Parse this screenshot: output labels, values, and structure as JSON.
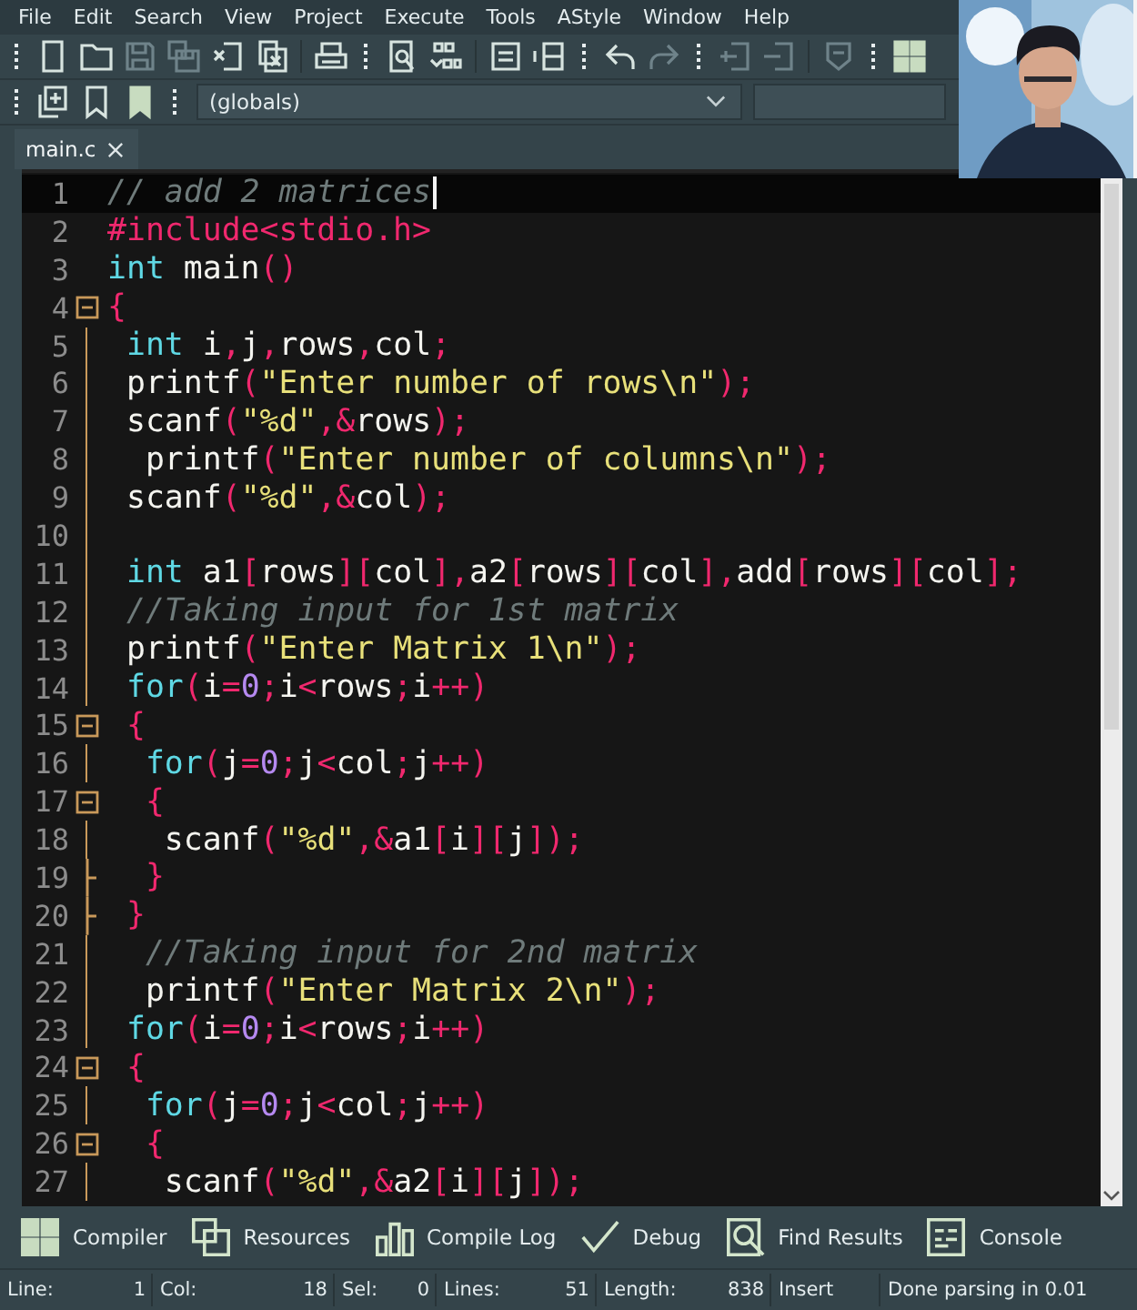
{
  "menu": [
    "File",
    "Edit",
    "Search",
    "View",
    "Project",
    "Execute",
    "Tools",
    "AStyle",
    "Window",
    "Help"
  ],
  "toolbar_rows": [
    [
      {
        "kind": "grip"
      },
      {
        "kind": "new",
        "disabled": false
      },
      {
        "kind": "open",
        "disabled": false
      },
      {
        "kind": "save",
        "disabled": true
      },
      {
        "kind": "save-all",
        "disabled": true
      },
      {
        "kind": "close",
        "disabled": false
      },
      {
        "kind": "close-all",
        "disabled": false
      },
      {
        "kind": "separator"
      },
      {
        "kind": "print",
        "disabled": false
      },
      {
        "kind": "grip"
      },
      {
        "kind": "find",
        "disabled": false
      },
      {
        "kind": "replace",
        "disabled": false
      },
      {
        "kind": "separator"
      },
      {
        "kind": "indent",
        "disabled": false
      },
      {
        "kind": "unindent",
        "disabled": false
      },
      {
        "kind": "grip"
      },
      {
        "kind": "undo",
        "disabled": false
      },
      {
        "kind": "redo",
        "disabled": true
      },
      {
        "kind": "grip"
      },
      {
        "kind": "insert",
        "disabled": true
      },
      {
        "kind": "remove",
        "disabled": true
      },
      {
        "kind": "separator"
      },
      {
        "kind": "shield",
        "disabled": true
      },
      {
        "kind": "grip"
      },
      {
        "kind": "grid",
        "disabled": false
      }
    ],
    [
      {
        "kind": "grip"
      },
      {
        "kind": "add-project",
        "disabled": false
      },
      {
        "kind": "bookmark",
        "disabled": false
      },
      {
        "kind": "bookmark-filled",
        "disabled": false
      },
      {
        "kind": "grip"
      }
    ]
  ],
  "scope_combo": {
    "value": "(globals)"
  },
  "tabs": [
    {
      "label": "main.c",
      "selected": true
    }
  ],
  "lines": [
    {
      "number": "1",
      "kind": "plain",
      "current": true,
      "tokens": [
        {
          "kind": "comment",
          "text": "// add 2 matrices"
        }
      ]
    },
    {
      "number": "2",
      "kind": "plain",
      "current": false,
      "tokens": [
        {
          "kind": "directive",
          "text": "#include<stdio.h>"
        }
      ]
    },
    {
      "number": "3",
      "kind": "plain",
      "current": false,
      "tokens": [
        {
          "kind": "keyword",
          "text": "int"
        },
        {
          "kind": "text",
          "text": " main"
        },
        {
          "kind": "symbol",
          "text": "()"
        }
      ]
    },
    {
      "number": "4",
      "kind": "fold-start",
      "current": false,
      "tokens": [
        {
          "kind": "symbol",
          "text": "{"
        }
      ]
    },
    {
      "number": "5",
      "kind": "plain",
      "current": false,
      "tokens": [
        {
          "kind": "keyword",
          "text": " int"
        },
        {
          "kind": "text",
          "text": " i"
        },
        {
          "kind": "symbol",
          "text": ","
        },
        {
          "kind": "text",
          "text": "j"
        },
        {
          "kind": "symbol",
          "text": ","
        },
        {
          "kind": "text",
          "text": "rows"
        },
        {
          "kind": "symbol",
          "text": ","
        },
        {
          "kind": "text",
          "text": "col"
        },
        {
          "kind": "symbol",
          "text": ";"
        }
      ]
    },
    {
      "number": "6",
      "kind": "plain",
      "current": false,
      "tokens": [
        {
          "kind": "text",
          "text": " printf"
        },
        {
          "kind": "symbol",
          "text": "("
        },
        {
          "kind": "string",
          "text": "\"Enter number of rows\\n\""
        },
        {
          "kind": "symbol",
          "text": ");"
        }
      ]
    },
    {
      "number": "7",
      "kind": "plain",
      "current": false,
      "tokens": [
        {
          "kind": "text",
          "text": " scanf"
        },
        {
          "kind": "symbol",
          "text": "("
        },
        {
          "kind": "string",
          "text": "\"%d\""
        },
        {
          "kind": "symbol",
          "text": ",&"
        },
        {
          "kind": "text",
          "text": "rows"
        },
        {
          "kind": "symbol",
          "text": ");"
        }
      ]
    },
    {
      "number": "8",
      "kind": "plain",
      "current": false,
      "tokens": [
        {
          "kind": "text",
          "text": "  printf"
        },
        {
          "kind": "symbol",
          "text": "("
        },
        {
          "kind": "string",
          "text": "\"Enter number of columns\\n\""
        },
        {
          "kind": "symbol",
          "text": ");"
        }
      ]
    },
    {
      "number": "9",
      "kind": "plain",
      "current": false,
      "tokens": [
        {
          "kind": "text",
          "text": " scanf"
        },
        {
          "kind": "symbol",
          "text": "("
        },
        {
          "kind": "string",
          "text": "\"%d\""
        },
        {
          "kind": "symbol",
          "text": ",&"
        },
        {
          "kind": "text",
          "text": "col"
        },
        {
          "kind": "symbol",
          "text": ");"
        }
      ]
    },
    {
      "number": "10",
      "kind": "plain",
      "current": false
    },
    {
      "number": "11",
      "kind": "plain",
      "current": false,
      "tokens": [
        {
          "kind": "keyword",
          "text": " int"
        },
        {
          "kind": "text",
          "text": " a1"
        },
        {
          "kind": "symbol",
          "text": "["
        },
        {
          "kind": "text",
          "text": "rows"
        },
        {
          "kind": "symbol",
          "text": "]["
        },
        {
          "kind": "text",
          "text": "col"
        },
        {
          "kind": "symbol",
          "text": "],"
        },
        {
          "kind": "text",
          "text": "a2"
        },
        {
          "kind": "symbol",
          "text": "["
        },
        {
          "kind": "text",
          "text": "rows"
        },
        {
          "kind": "symbol",
          "text": "]["
        },
        {
          "kind": "text",
          "text": "col"
        },
        {
          "kind": "symbol",
          "text": "],"
        },
        {
          "kind": "text",
          "text": "add"
        },
        {
          "kind": "symbol",
          "text": "["
        },
        {
          "kind": "text",
          "text": "rows"
        },
        {
          "kind": "symbol",
          "text": "]["
        },
        {
          "kind": "text",
          "text": "col"
        },
        {
          "kind": "symbol",
          "text": "];"
        }
      ]
    },
    {
      "number": "12",
      "kind": "plain",
      "current": false,
      "tokens": [
        {
          "kind": "comment",
          "text": " //Taking input for 1st matrix"
        }
      ]
    },
    {
      "number": "13",
      "kind": "plain",
      "current": false,
      "tokens": [
        {
          "kind": "text",
          "text": " printf"
        },
        {
          "kind": "symbol",
          "text": "("
        },
        {
          "kind": "string",
          "text": "\"Enter Matrix 1\\n\""
        },
        {
          "kind": "symbol",
          "text": ");"
        }
      ]
    },
    {
      "number": "14",
      "kind": "plain",
      "current": false,
      "tokens": [
        {
          "kind": "keyword",
          "text": " for"
        },
        {
          "kind": "symbol",
          "text": "("
        },
        {
          "kind": "text",
          "text": "i"
        },
        {
          "kind": "symbol",
          "text": "="
        },
        {
          "kind": "number",
          "text": "0"
        },
        {
          "kind": "symbol",
          "text": ";"
        },
        {
          "kind": "text",
          "text": "i"
        },
        {
          "kind": "symbol",
          "text": "<"
        },
        {
          "kind": "text",
          "text": "rows"
        },
        {
          "kind": "symbol",
          "text": ";"
        },
        {
          "kind": "text",
          "text": "i"
        },
        {
          "kind": "symbol",
          "text": "++)"
        }
      ]
    },
    {
      "number": "15",
      "kind": "fold-start",
      "current": false,
      "tokens": [
        {
          "kind": "symbol",
          "text": " {"
        }
      ]
    },
    {
      "number": "16",
      "kind": "plain",
      "current": false,
      "tokens": [
        {
          "kind": "keyword",
          "text": "  for"
        },
        {
          "kind": "symbol",
          "text": "("
        },
        {
          "kind": "text",
          "text": "j"
        },
        {
          "kind": "symbol",
          "text": "="
        },
        {
          "kind": "number",
          "text": "0"
        },
        {
          "kind": "symbol",
          "text": ";"
        },
        {
          "kind": "text",
          "text": "j"
        },
        {
          "kind": "symbol",
          "text": "<"
        },
        {
          "kind": "text",
          "text": "col"
        },
        {
          "kind": "symbol",
          "text": ";"
        },
        {
          "kind": "text",
          "text": "j"
        },
        {
          "kind": "symbol",
          "text": "++)"
        }
      ]
    },
    {
      "number": "17",
      "kind": "fold-start",
      "current": false,
      "tokens": [
        {
          "kind": "symbol",
          "text": "  {"
        }
      ]
    },
    {
      "number": "18",
      "kind": "plain",
      "current": false,
      "tokens": [
        {
          "kind": "text",
          "text": "   scanf"
        },
        {
          "kind": "symbol",
          "text": "("
        },
        {
          "kind": "string",
          "text": "\"%d\""
        },
        {
          "kind": "symbol",
          "text": ",&"
        },
        {
          "kind": "text",
          "text": "a1"
        },
        {
          "kind": "symbol",
          "text": "["
        },
        {
          "kind": "text",
          "text": "i"
        },
        {
          "kind": "symbol",
          "text": "]["
        },
        {
          "kind": "text",
          "text": "j"
        },
        {
          "kind": "symbol",
          "text": "]);"
        }
      ]
    },
    {
      "number": "19",
      "kind": "fold-end",
      "current": false,
      "tokens": [
        {
          "kind": "symbol",
          "text": "  }"
        }
      ]
    },
    {
      "number": "20",
      "kind": "fold-end",
      "current": false,
      "tokens": [
        {
          "kind": "symbol",
          "text": " }"
        }
      ]
    },
    {
      "number": "21",
      "kind": "plain",
      "current": false,
      "tokens": [
        {
          "kind": "comment",
          "text": "  //Taking input for 2nd matrix"
        }
      ]
    },
    {
      "number": "22",
      "kind": "plain",
      "current": false,
      "tokens": [
        {
          "kind": "text",
          "text": "  printf"
        },
        {
          "kind": "symbol",
          "text": "("
        },
        {
          "kind": "string",
          "text": "\"Enter Matrix 2\\n\""
        },
        {
          "kind": "symbol",
          "text": ");"
        }
      ]
    },
    {
      "number": "23",
      "kind": "plain",
      "current": false,
      "tokens": [
        {
          "kind": "keyword",
          "text": " for"
        },
        {
          "kind": "symbol",
          "text": "("
        },
        {
          "kind": "text",
          "text": "i"
        },
        {
          "kind": "symbol",
          "text": "="
        },
        {
          "kind": "number",
          "text": "0"
        },
        {
          "kind": "symbol",
          "text": ";"
        },
        {
          "kind": "text",
          "text": "i"
        },
        {
          "kind": "symbol",
          "text": "<"
        },
        {
          "kind": "text",
          "text": "rows"
        },
        {
          "kind": "symbol",
          "text": ";"
        },
        {
          "kind": "text",
          "text": "i"
        },
        {
          "kind": "symbol",
          "text": "++)"
        }
      ]
    },
    {
      "number": "24",
      "kind": "fold-start",
      "current": false,
      "tokens": [
        {
          "kind": "symbol",
          "text": " {"
        }
      ]
    },
    {
      "number": "25",
      "kind": "plain",
      "current": false,
      "tokens": [
        {
          "kind": "keyword",
          "text": "  for"
        },
        {
          "kind": "symbol",
          "text": "("
        },
        {
          "kind": "text",
          "text": "j"
        },
        {
          "kind": "symbol",
          "text": "="
        },
        {
          "kind": "number",
          "text": "0"
        },
        {
          "kind": "symbol",
          "text": ";"
        },
        {
          "kind": "text",
          "text": "j"
        },
        {
          "kind": "symbol",
          "text": "<"
        },
        {
          "kind": "text",
          "text": "col"
        },
        {
          "kind": "symbol",
          "text": ";"
        },
        {
          "kind": "text",
          "text": "j"
        },
        {
          "kind": "symbol",
          "text": "++)"
        }
      ]
    },
    {
      "number": "26",
      "kind": "fold-start",
      "current": false,
      "tokens": [
        {
          "kind": "symbol",
          "text": "  {"
        }
      ]
    },
    {
      "number": "27",
      "kind": "plain",
      "current": false,
      "tokens": [
        {
          "kind": "text",
          "text": "   scanf"
        },
        {
          "kind": "symbol",
          "text": "("
        },
        {
          "kind": "string",
          "text": "\"%d\""
        },
        {
          "kind": "symbol",
          "text": ",&"
        },
        {
          "kind": "text",
          "text": "a2"
        },
        {
          "kind": "symbol",
          "text": "["
        },
        {
          "kind": "text",
          "text": "i"
        },
        {
          "kind": "symbol",
          "text": "]["
        },
        {
          "kind": "text",
          "text": "j"
        },
        {
          "kind": "symbol",
          "text": "]);"
        }
      ]
    }
  ],
  "bottom_tabs": [
    {
      "label": "Compiler",
      "kind": "grid"
    },
    {
      "label": "Resources",
      "kind": "resources"
    },
    {
      "label": "Compile Log",
      "kind": "log"
    },
    {
      "label": "Debug",
      "kind": "debug"
    },
    {
      "label": "Find Results",
      "kind": "find-results"
    },
    {
      "label": "Console",
      "kind": "console"
    }
  ],
  "status_bar": [
    {
      "label": "Line:",
      "value": "1"
    },
    {
      "label": "Col:",
      "value": "18"
    },
    {
      "label": "Sel:",
      "value": "0"
    },
    {
      "label": "Lines:",
      "value": "51"
    },
    {
      "label": "Length:",
      "value": "838"
    },
    {
      "label": "Insert"
    },
    {
      "label": "Done parsing in 0.01"
    }
  ],
  "webcam": {
    "kind": "picture"
  }
}
